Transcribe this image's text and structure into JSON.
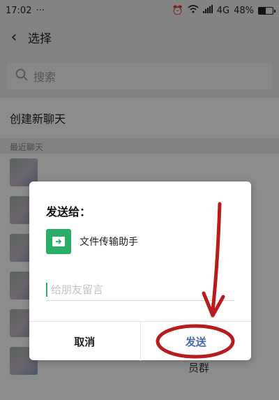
{
  "status": {
    "time": "17:02",
    "dots": "···",
    "network": "4G",
    "battery_text": "48%",
    "battery_level": 0.48
  },
  "header": {
    "title": "选择"
  },
  "search": {
    "placeholder": "搜索"
  },
  "create_chat": "创建新聊天",
  "recent_label": "最近聊天",
  "partial_list_text": "员群",
  "dialog": {
    "title": "发送给：",
    "target_name": "文件传输助手",
    "message_placeholder": "给朋友留言",
    "cancel_label": "取消",
    "send_label": "发送"
  },
  "colors": {
    "accent_green": "#2aae67",
    "send_blue": "#4a6aa8",
    "annotation_red": "#b81b1b"
  },
  "icons": [
    "back-chevron-icon",
    "search-icon",
    "alarm-icon",
    "wifi-icon",
    "signal-icon",
    "battery-icon",
    "file-transfer-icon"
  ]
}
